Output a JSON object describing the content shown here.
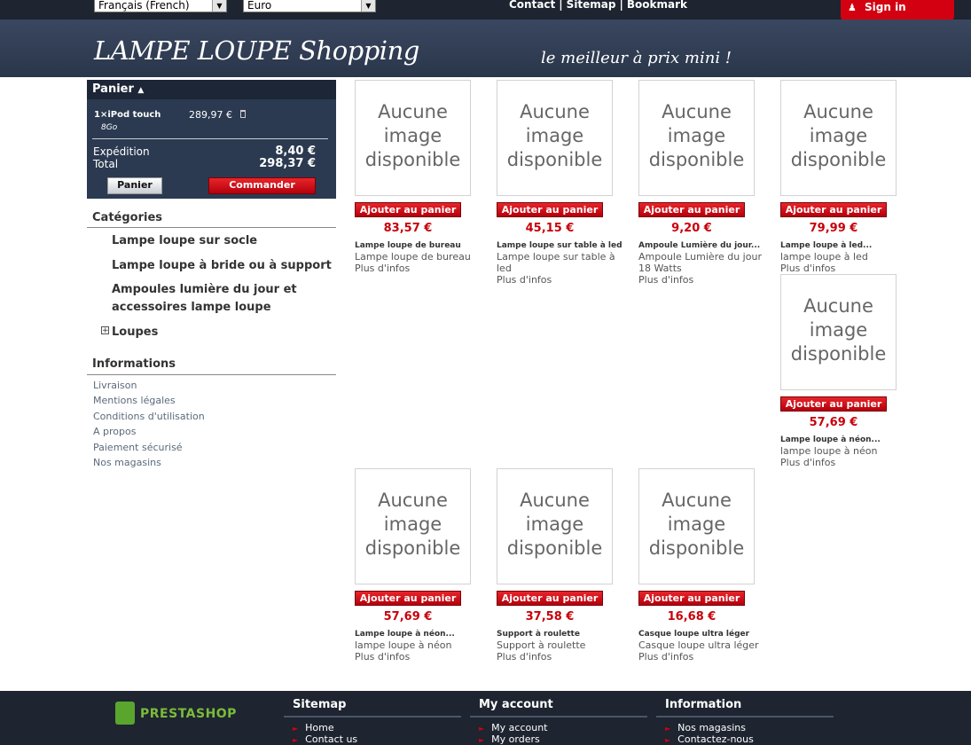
{
  "topbar": {
    "language": "Français (French)",
    "currency": "Euro",
    "links": [
      "Contact",
      "Sitemap",
      "Bookmark"
    ],
    "signin": "Sign in"
  },
  "header": {
    "logo": "LAMPE LOUPE Shopping",
    "slogan": "le meilleur à prix mini !"
  },
  "cart": {
    "title": "Panier",
    "item_qty_name": "1×iPod touch",
    "item_variant": "8Go",
    "item_price": "289,97 €",
    "shipping_label": "Expédition",
    "shipping_value": "8,40 €",
    "total_label": "Total",
    "total_value": "298,37 €",
    "btn_cart": "Panier",
    "btn_order": "Commander"
  },
  "categories": {
    "title": "Catégories",
    "items": [
      "Lampe loupe sur socle",
      "Lampe loupe à bride ou à support",
      "Ampoules lumière du jour et accessoires lampe loupe",
      "Loupes"
    ]
  },
  "informations": {
    "title": "Informations",
    "links": [
      "Livraison",
      "Mentions légales",
      "Conditions d'utilisation",
      "A propos",
      "Paiement sécurisé",
      "Nos magasins"
    ]
  },
  "no_image_text": "Aucune image disponible",
  "add_label": "Ajouter au panier",
  "more_label": "Plus d'infos",
  "products": [
    {
      "price": "83,57 €",
      "title": "Lampe loupe de bureau",
      "desc": "Lampe loupe de bureau"
    },
    {
      "price": "45,15 €",
      "title": "Lampe loupe sur table à led",
      "desc": "Lampe loupe sur table à led"
    },
    {
      "price": "9,20 €",
      "title": "Ampoule Lumière du jour...",
      "desc": "Ampoule Lumière du jour 18 Watts"
    },
    {
      "price": "79,99 €",
      "title": "Lampe loupe à led...",
      "desc": "lampe loupe à led"
    },
    {
      "price": "57,69 €",
      "title": "Lampe loupe à néon...",
      "desc": "lampe loupe à néon"
    },
    {
      "price": "57,69 €",
      "title": "Lampe loupe à néon...",
      "desc": "lampe loupe à néon"
    },
    {
      "price": "37,58 €",
      "title": "Support à roulette",
      "desc": "Support à roulette"
    },
    {
      "price": "16,68 €",
      "title": "Casque loupe ultra léger",
      "desc": "Casque loupe ultra léger"
    }
  ],
  "footer": {
    "brand": "PRESTASHOP",
    "sitemap": {
      "title": "Sitemap",
      "links": [
        "Home",
        "Contact us"
      ]
    },
    "account": {
      "title": "My account",
      "links": [
        "My account",
        "My orders"
      ]
    },
    "information": {
      "title": "Information",
      "links": [
        "Nos magasins",
        "Contactez-nous"
      ]
    }
  }
}
